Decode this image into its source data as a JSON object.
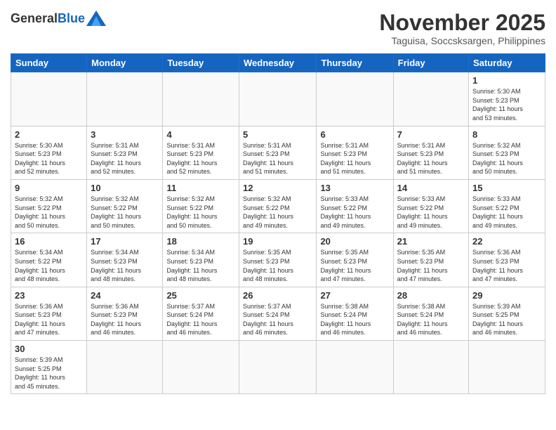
{
  "logo": {
    "general": "General",
    "blue": "Blue"
  },
  "header": {
    "month": "November 2025",
    "location": "Taguisa, Soccsksargen, Philippines"
  },
  "weekdays": [
    "Sunday",
    "Monday",
    "Tuesday",
    "Wednesday",
    "Thursday",
    "Friday",
    "Saturday"
  ],
  "weeks": [
    [
      {
        "day": "",
        "info": ""
      },
      {
        "day": "",
        "info": ""
      },
      {
        "day": "",
        "info": ""
      },
      {
        "day": "",
        "info": ""
      },
      {
        "day": "",
        "info": ""
      },
      {
        "day": "",
        "info": ""
      },
      {
        "day": "1",
        "info": "Sunrise: 5:30 AM\nSunset: 5:23 PM\nDaylight: 11 hours\nand 53 minutes."
      }
    ],
    [
      {
        "day": "2",
        "info": "Sunrise: 5:30 AM\nSunset: 5:23 PM\nDaylight: 11 hours\nand 52 minutes."
      },
      {
        "day": "3",
        "info": "Sunrise: 5:31 AM\nSunset: 5:23 PM\nDaylight: 11 hours\nand 52 minutes."
      },
      {
        "day": "4",
        "info": "Sunrise: 5:31 AM\nSunset: 5:23 PM\nDaylight: 11 hours\nand 52 minutes."
      },
      {
        "day": "5",
        "info": "Sunrise: 5:31 AM\nSunset: 5:23 PM\nDaylight: 11 hours\nand 51 minutes."
      },
      {
        "day": "6",
        "info": "Sunrise: 5:31 AM\nSunset: 5:23 PM\nDaylight: 11 hours\nand 51 minutes."
      },
      {
        "day": "7",
        "info": "Sunrise: 5:31 AM\nSunset: 5:23 PM\nDaylight: 11 hours\nand 51 minutes."
      },
      {
        "day": "8",
        "info": "Sunrise: 5:32 AM\nSunset: 5:23 PM\nDaylight: 11 hours\nand 50 minutes."
      }
    ],
    [
      {
        "day": "9",
        "info": "Sunrise: 5:32 AM\nSunset: 5:22 PM\nDaylight: 11 hours\nand 50 minutes."
      },
      {
        "day": "10",
        "info": "Sunrise: 5:32 AM\nSunset: 5:22 PM\nDaylight: 11 hours\nand 50 minutes."
      },
      {
        "day": "11",
        "info": "Sunrise: 5:32 AM\nSunset: 5:22 PM\nDaylight: 11 hours\nand 50 minutes."
      },
      {
        "day": "12",
        "info": "Sunrise: 5:32 AM\nSunset: 5:22 PM\nDaylight: 11 hours\nand 49 minutes."
      },
      {
        "day": "13",
        "info": "Sunrise: 5:33 AM\nSunset: 5:22 PM\nDaylight: 11 hours\nand 49 minutes."
      },
      {
        "day": "14",
        "info": "Sunrise: 5:33 AM\nSunset: 5:22 PM\nDaylight: 11 hours\nand 49 minutes."
      },
      {
        "day": "15",
        "info": "Sunrise: 5:33 AM\nSunset: 5:22 PM\nDaylight: 11 hours\nand 49 minutes."
      }
    ],
    [
      {
        "day": "16",
        "info": "Sunrise: 5:34 AM\nSunset: 5:22 PM\nDaylight: 11 hours\nand 48 minutes."
      },
      {
        "day": "17",
        "info": "Sunrise: 5:34 AM\nSunset: 5:23 PM\nDaylight: 11 hours\nand 48 minutes."
      },
      {
        "day": "18",
        "info": "Sunrise: 5:34 AM\nSunset: 5:23 PM\nDaylight: 11 hours\nand 48 minutes."
      },
      {
        "day": "19",
        "info": "Sunrise: 5:35 AM\nSunset: 5:23 PM\nDaylight: 11 hours\nand 48 minutes."
      },
      {
        "day": "20",
        "info": "Sunrise: 5:35 AM\nSunset: 5:23 PM\nDaylight: 11 hours\nand 47 minutes."
      },
      {
        "day": "21",
        "info": "Sunrise: 5:35 AM\nSunset: 5:23 PM\nDaylight: 11 hours\nand 47 minutes."
      },
      {
        "day": "22",
        "info": "Sunrise: 5:36 AM\nSunset: 5:23 PM\nDaylight: 11 hours\nand 47 minutes."
      }
    ],
    [
      {
        "day": "23",
        "info": "Sunrise: 5:36 AM\nSunset: 5:23 PM\nDaylight: 11 hours\nand 47 minutes."
      },
      {
        "day": "24",
        "info": "Sunrise: 5:36 AM\nSunset: 5:23 PM\nDaylight: 11 hours\nand 46 minutes."
      },
      {
        "day": "25",
        "info": "Sunrise: 5:37 AM\nSunset: 5:24 PM\nDaylight: 11 hours\nand 46 minutes."
      },
      {
        "day": "26",
        "info": "Sunrise: 5:37 AM\nSunset: 5:24 PM\nDaylight: 11 hours\nand 46 minutes."
      },
      {
        "day": "27",
        "info": "Sunrise: 5:38 AM\nSunset: 5:24 PM\nDaylight: 11 hours\nand 46 minutes."
      },
      {
        "day": "28",
        "info": "Sunrise: 5:38 AM\nSunset: 5:24 PM\nDaylight: 11 hours\nand 46 minutes."
      },
      {
        "day": "29",
        "info": "Sunrise: 5:39 AM\nSunset: 5:25 PM\nDaylight: 11 hours\nand 46 minutes."
      }
    ],
    [
      {
        "day": "30",
        "info": "Sunrise: 5:39 AM\nSunset: 5:25 PM\nDaylight: 11 hours\nand 45 minutes."
      },
      {
        "day": "",
        "info": ""
      },
      {
        "day": "",
        "info": ""
      },
      {
        "day": "",
        "info": ""
      },
      {
        "day": "",
        "info": ""
      },
      {
        "day": "",
        "info": ""
      },
      {
        "day": "",
        "info": ""
      }
    ]
  ]
}
